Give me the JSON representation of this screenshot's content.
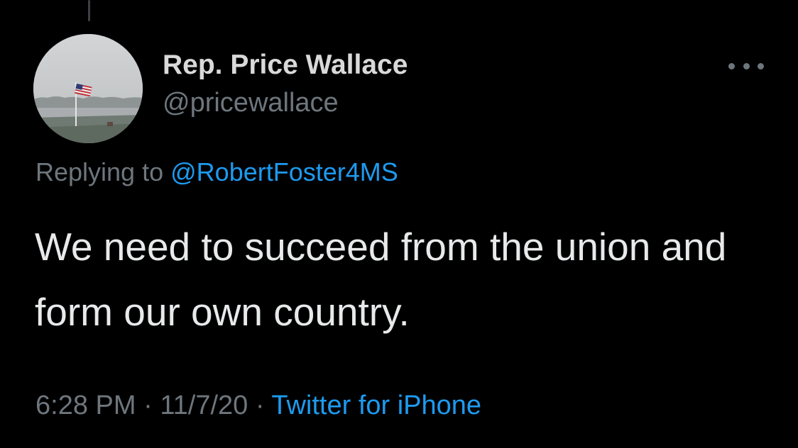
{
  "author": {
    "display_name": "Rep. Price Wallace",
    "handle": "@pricewallace",
    "avatar_icon": "avatar-flag-landscape"
  },
  "reply": {
    "prefix": "Replying to",
    "mention": "@RobertFoster4MS"
  },
  "tweet": {
    "text": "We need to succeed from the union and form our own country."
  },
  "meta": {
    "time": "6:28 PM",
    "separator": "·",
    "date": "11/7/20",
    "source": "Twitter for iPhone"
  },
  "menu": {
    "icon": "more-horizontal-icon"
  },
  "colors": {
    "background": "#000000",
    "link": "#1d9bf0",
    "secondary_text": "#6e767d",
    "primary_text": "#e7e9ea"
  }
}
